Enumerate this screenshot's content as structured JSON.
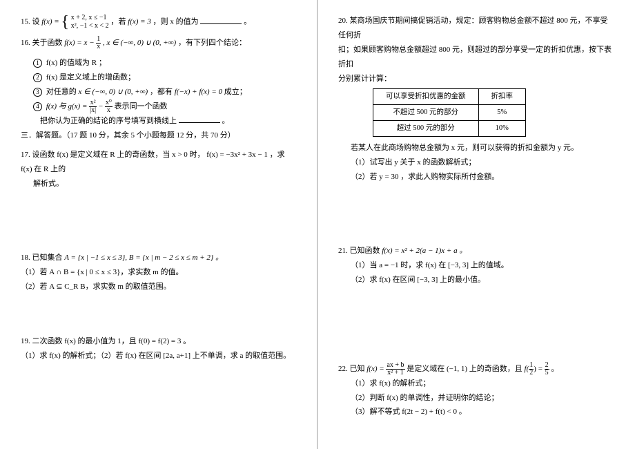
{
  "left": {
    "q15": {
      "prefix": "15. 设",
      "fx": "f(x) =",
      "piece1": "x + 2, x ≤ −1",
      "piece2": "x², −1 < x < 2",
      "mid": "，若",
      "cond": "f(x) = 3",
      "then": "，则 x 的值为",
      "end": "。"
    },
    "q16": {
      "prefix": "16. 关于函数",
      "func": "f(x) = x −",
      "frac_n": "1",
      "frac_d": "x",
      "domain": ", x ∈ (−∞, 0) ∪ (0, +∞)",
      "tail": "，有下列四个结论：",
      "c1": "f(x) 的值域为 R ；",
      "c2": "f(x) 是定义域上的增函数；",
      "c3_pre": "对任意的",
      "c3_set": "x ∈ (−∞, 0) ∪ (0, +∞)",
      "c3_mid": "，都有",
      "c3_eq": "f(−x) + f(x) = 0",
      "c3_end": "成立；",
      "c4_pre": "f(x) 与 g(x) =",
      "c4_n": "x²",
      "c4_d": "|x|",
      "c4_minus": " − ",
      "c4_n2": "x⁰",
      "c4_d2": "x",
      "c4_end": " 表示同一个函数",
      "bottom": "把你认为正确的结论的序号填写到横线上",
      "bottom_end": "。"
    },
    "section3": "三．解答题。（17 题 10 分，其余 5 个小题每题 12 分，共 70 分）",
    "q17": {
      "line1": "17. 设函数 f(x) 是定义域在 R 上的奇函数，当 x > 0 时， f(x) = −3x² + 3x − 1 ，求 f(x) 在 R 上的",
      "line2": "解析式。"
    },
    "q18": {
      "prefix": "18. 已知集合",
      "sets": "A = {x | −1 ≤ x ≤ 3}, B = {x | m − 2 ≤ x ≤ m + 2} 。",
      "p1": "（1）若 A ∩ B = {x | 0 ≤ x ≤ 3}，求实数 m 的值。",
      "p2": "（2）若 A ⊆ C_R B，求实数 m 的取值范围。"
    },
    "q19": {
      "line1": "19. 二次函数 f(x) 的最小值为 1，且 f(0) = f(2) = 3 。",
      "line2": "（1）求 f(x) 的解析式；（2）若 f(x) 在区间 [2a, a+1] 上不单调，求 a 的取值范围。"
    }
  },
  "right": {
    "q20": {
      "line1": "20. 某商场国庆节期间搞促销活动，规定：顾客购物总金额不超过 800 元，不享受任何折",
      "line2": "扣；如果顾客购物总金额超过 800 元，则超过的部分享受一定的折扣优惠，按下表折扣",
      "line3": "分别累计计算：",
      "th1": "可以享受折扣优惠的金额",
      "th2": "折扣率",
      "r1c1": "不超过 500 元的部分",
      "r1c2": "5%",
      "r2c1": "超过 500 元的部分",
      "r2c2": "10%",
      "after1": "若某人在此商场购物总金额为 x 元，则可以获得的折扣金额为 y 元。",
      "p1": "（1）试写出 y 关于 x 的函数解析式；",
      "p2": "（2）若 y = 30 ，求此人购物实际所付金额。"
    },
    "q21": {
      "prefix": "21. 已知函数",
      "func": "f(x) = x² + 2(a − 1)x + a 。",
      "p1": "（1）当 a = −1 时，求 f(x) 在 [−3, 3] 上的值域。",
      "p2": "（2）求 f(x) 在区间 [−3, 3] 上的最小值。"
    },
    "q22": {
      "prefix": "22. 已知",
      "func_pre": "f(x) =",
      "frac_n": "ax + b",
      "frac_d": "x² + 1",
      "mid": " 是定义域在 (−1, 1) 上的奇函数，且",
      "cond_pre": "f(",
      "cond_n": "1",
      "cond_d": "2",
      "cond_mid": ") = ",
      "val_n": "2",
      "val_d": "5",
      "end": "。",
      "p1": "（1）求 f(x) 的解析式；",
      "p2": "（2）判断 f(x) 的单调性，并证明你的结论；",
      "p3": "（3）解不等式 f(2t − 2) + f(t) < 0 。"
    }
  }
}
